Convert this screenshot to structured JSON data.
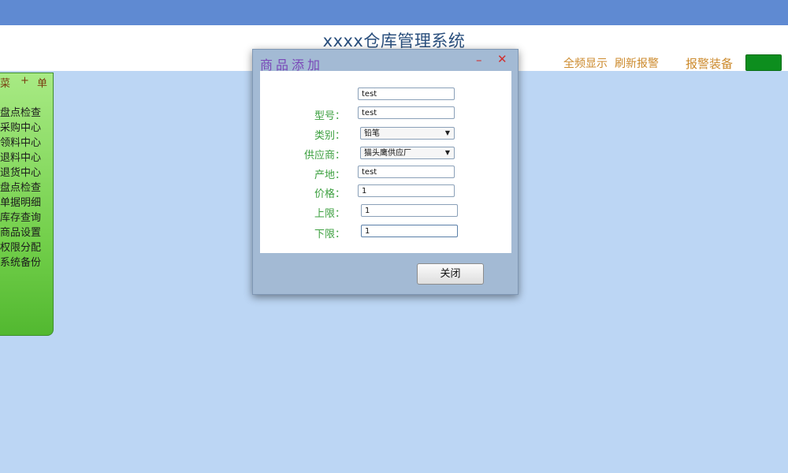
{
  "app": {
    "title": "xxxx仓库管理系统"
  },
  "header": {
    "show_all": "全频显示",
    "refresh_alarm": "刷新报警",
    "alarm_equipment": "报警装备"
  },
  "sidebar": {
    "header": [
      "菜",
      "+",
      "单"
    ],
    "items": [
      "盘点检查",
      "采购中心",
      "领料中心",
      "退料中心",
      "退货中心",
      "盘点检查",
      "单据明细",
      "库存查询",
      "商品设置",
      "权限分配",
      "系统备份"
    ]
  },
  "dialog": {
    "title": "商品添加",
    "minimize": "–",
    "close": "✕",
    "fields": {
      "name_value": "test",
      "model_label": "型号：",
      "model_value": "test",
      "category_label": "类别：",
      "category_value": "铅笔",
      "supplier_label": "供应商：",
      "supplier_value": "猫头鹰供应厂",
      "origin_label": "产地：",
      "origin_value": "test",
      "price_label": "价格：",
      "price_value": "1",
      "upper_label": "上限：",
      "upper_value": "1",
      "lower_label": "下限：",
      "lower_value": "1"
    },
    "close_button": "关闭"
  },
  "colors": {
    "topbar": "#5f8ad2",
    "background": "#bcd6f4",
    "sidebar": "#72cf4a",
    "green_button": "#0d8e1e"
  }
}
